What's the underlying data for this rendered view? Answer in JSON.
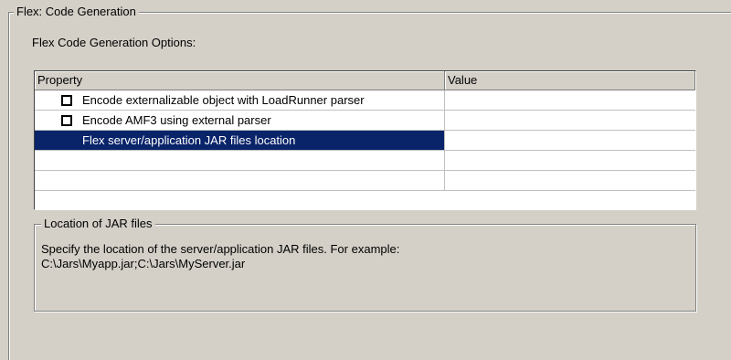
{
  "group": {
    "title": "Flex: Code Generation"
  },
  "options": {
    "label": "Flex Code Generation Options:"
  },
  "grid": {
    "columns": [
      "Property",
      "Value"
    ],
    "rows": [
      {
        "type": "checkbox",
        "checked": false,
        "label": "Encode externalizable object with LoadRunner parser",
        "value": ""
      },
      {
        "type": "checkbox",
        "checked": false,
        "label": "Encode AMF3 using external parser",
        "value": ""
      },
      {
        "type": "text",
        "selected": true,
        "label": "Flex server/application JAR files location",
        "value": ""
      },
      {
        "type": "empty",
        "label": "",
        "value": ""
      },
      {
        "type": "empty",
        "label": "",
        "value": ""
      }
    ]
  },
  "description": {
    "title": "Location of JAR files",
    "line1": "Specify the location of the server/application JAR files. For example:",
    "line2": "C:\\Jars\\Myapp.jar;C:\\Jars\\MyServer.jar"
  },
  "colors": {
    "selection": "#0a246a",
    "dialog_bg": "#d4d0c8"
  }
}
